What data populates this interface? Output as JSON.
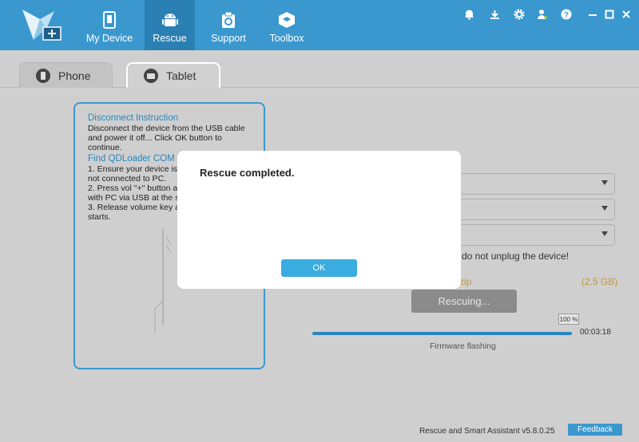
{
  "nav": {
    "tabs": [
      {
        "label": "My Device",
        "icon": "phone-icon",
        "active": false
      },
      {
        "label": "Rescue",
        "icon": "android-icon",
        "active": true
      },
      {
        "label": "Support",
        "icon": "support-icon",
        "active": false
      },
      {
        "label": "Toolbox",
        "icon": "toolbox-icon",
        "active": false
      }
    ],
    "top_icons": [
      "bell-icon",
      "download-icon",
      "gear-icon",
      "user-icon",
      "help-icon",
      "minimize-icon",
      "maximize-icon",
      "close-icon"
    ]
  },
  "device_tabs": [
    {
      "label": "Phone",
      "active": false
    },
    {
      "label": "Tablet",
      "active": true
    }
  ],
  "instructions": {
    "heading1": "Disconnect Instruction",
    "text1": "Disconnect the device from the USB cable and power it off... Click OK button to continue.",
    "heading2": "Find QDLoader COM",
    "step1": "1. Ensure your device is",
    "step1b": "not connected to PC.",
    "step2": "2. Press vol \"+\" button a",
    "step2b": "with PC via USB at the s",
    "step3": "3. Release volume key a",
    "step3b": "starts."
  },
  "main": {
    "warning_fragment": "do not unplug the device!",
    "rom_fragment": "zip",
    "rom_size": "(2.5 GB)",
    "rescuing_button": "Rescuing...",
    "progress_percent_label": "100 %",
    "progress_value": 1.0,
    "elapsed": "00:03:18",
    "status": "Firmware flashing"
  },
  "footer": {
    "version": "Rescue and Smart Assistant v5.8.0.25",
    "feedback": "Feedback"
  },
  "modal": {
    "message": "Rescue completed.",
    "ok": "OK"
  },
  "colors": {
    "header": "#3a98cf",
    "active_tab": "#2a7fb3",
    "accent": "#3aace0",
    "rom_text": "#c8963a"
  }
}
